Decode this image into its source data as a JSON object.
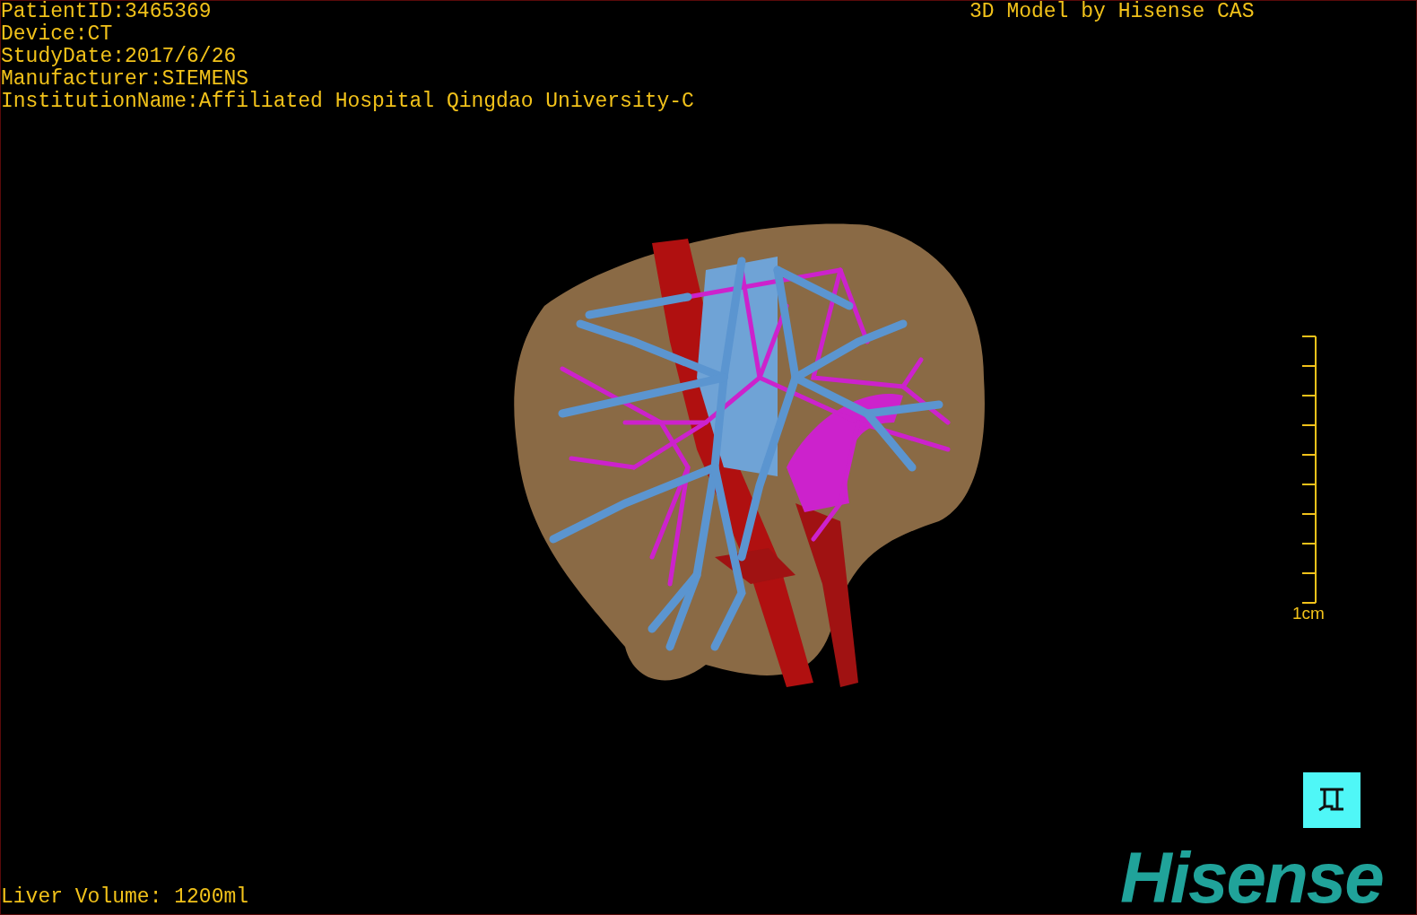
{
  "info_lines": [
    "PatientID:3465369",
    "Device:CT",
    "StudyDate:2017/6/26",
    "Manufacturer:SIEMENS",
    "InstitutionName:Affiliated Hospital Qingdao University-C"
  ],
  "header_right": "3D Model by Hisense CAS",
  "scale_bar": {
    "label": "1cm"
  },
  "liver_volume": "Liver Volume: 1200ml",
  "logo": "Hisense"
}
